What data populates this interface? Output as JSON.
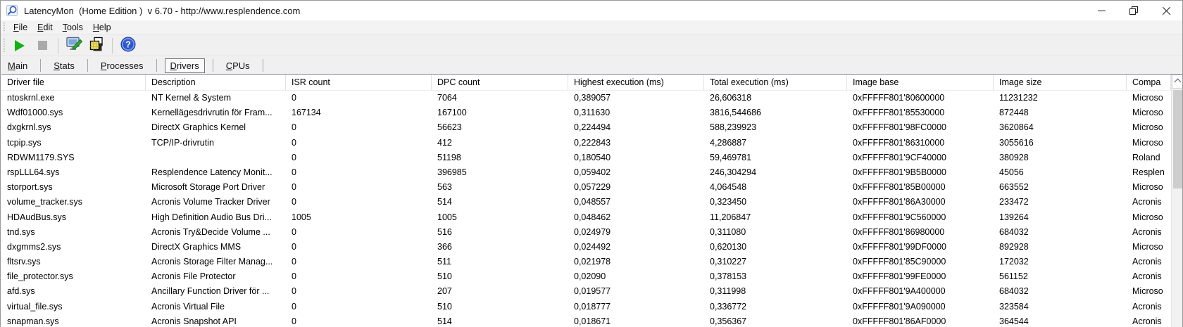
{
  "window": {
    "title": "LatencyMon  (Home Edition )  v 6.70 - http://www.resplendence.com",
    "app_icon": "latencymon-magnifier-icon",
    "controls": [
      "minimize",
      "restore",
      "close"
    ]
  },
  "menu": {
    "items": [
      "File",
      "Edit",
      "Tools",
      "Help"
    ]
  },
  "toolbar": {
    "buttons": [
      {
        "name": "start-monitor-button",
        "icon": "play-icon",
        "enabled": true
      },
      {
        "name": "stop-monitor-button",
        "icon": "stop-icon",
        "enabled": false
      },
      {
        "name": "separator"
      },
      {
        "name": "edit-options-button",
        "icon": "monitor-pencil-icon",
        "enabled": true
      },
      {
        "name": "report-button",
        "icon": "stacked-windows-icon",
        "enabled": true
      },
      {
        "name": "separator"
      },
      {
        "name": "help-button",
        "icon": "help-question-icon",
        "enabled": true
      }
    ]
  },
  "tabs": [
    {
      "label": "Main",
      "selected": false
    },
    {
      "label": "Stats",
      "selected": false
    },
    {
      "label": "Processes",
      "selected": false
    },
    {
      "label": "Drivers",
      "selected": true
    },
    {
      "label": "CPUs",
      "selected": false
    }
  ],
  "table": {
    "columns": [
      "Driver file",
      "Description",
      "ISR count",
      "DPC count",
      "Highest execution (ms)",
      "Total execution (ms)",
      "Image base",
      "Image size",
      "Compa"
    ],
    "column_keys": [
      "driver-file",
      "description",
      "isr-count",
      "dpc-count",
      "highest-execution",
      "total-execution",
      "image-base",
      "image-size",
      "company"
    ],
    "rows": [
      [
        "ntoskrnl.exe",
        "NT Kernel & System",
        "0",
        "7064",
        "0,389057",
        "26,606318",
        "0xFFFFF801'80600000",
        "11231232",
        "Microso"
      ],
      [
        "Wdf01000.sys",
        "Kernellägesdrivrutin för Fram...",
        "167134",
        "167100",
        "0,311630",
        "3816,544686",
        "0xFFFFF801'85530000",
        "872448",
        "Microso"
      ],
      [
        "dxgkrnl.sys",
        "DirectX Graphics Kernel",
        "0",
        "56623",
        "0,224494",
        "588,239923",
        "0xFFFFF801'98FC0000",
        "3620864",
        "Microso"
      ],
      [
        "tcpip.sys",
        "TCP/IP-drivrutin",
        "0",
        "412",
        "0,222843",
        "4,286887",
        "0xFFFFF801'86310000",
        "3055616",
        "Microso"
      ],
      [
        "RDWM1179.SYS",
        "",
        "0",
        "51198",
        "0,180540",
        "59,469781",
        "0xFFFFF801'9CF40000",
        "380928",
        "Roland"
      ],
      [
        "rspLLL64.sys",
        "Resplendence Latency Monit...",
        "0",
        "396985",
        "0,059402",
        "246,304294",
        "0xFFFFF801'9B5B0000",
        "45056",
        "Resplen"
      ],
      [
        "storport.sys",
        "Microsoft Storage Port Driver",
        "0",
        "563",
        "0,057229",
        "4,064548",
        "0xFFFFF801'85B00000",
        "663552",
        "Microso"
      ],
      [
        "volume_tracker.sys",
        "Acronis Volume Tracker Driver",
        "0",
        "514",
        "0,048557",
        "0,323450",
        "0xFFFFF801'86A30000",
        "233472",
        "Acronis"
      ],
      [
        "HDAudBus.sys",
        "High Definition Audio Bus Dri...",
        "1005",
        "1005",
        "0,048462",
        "11,206847",
        "0xFFFFF801'9C560000",
        "139264",
        "Microso"
      ],
      [
        "tnd.sys",
        "Acronis Try&Decide Volume ...",
        "0",
        "516",
        "0,024979",
        "0,311080",
        "0xFFFFF801'86980000",
        "684032",
        "Acronis"
      ],
      [
        "dxgmms2.sys",
        "DirectX Graphics MMS",
        "0",
        "366",
        "0,024492",
        "0,620130",
        "0xFFFFF801'99DF0000",
        "892928",
        "Microso"
      ],
      [
        "fltsrv.sys",
        "Acronis Storage Filter Manag...",
        "0",
        "511",
        "0,021978",
        "0,310227",
        "0xFFFFF801'85C90000",
        "172032",
        "Acronis"
      ],
      [
        "file_protector.sys",
        "Acronis File Protector",
        "0",
        "510",
        "0,02090",
        "0,378153",
        "0xFFFFF801'99FE0000",
        "561152",
        "Acronis"
      ],
      [
        "afd.sys",
        "Ancillary Function Driver för ...",
        "0",
        "207",
        "0,019577",
        "0,311998",
        "0xFFFFF801'9A400000",
        "684032",
        "Microso"
      ],
      [
        "virtual_file.sys",
        "Acronis Virtual File",
        "0",
        "510",
        "0,018777",
        "0,336772",
        "0xFFFFF801'9A090000",
        "323584",
        "Acronis"
      ],
      [
        "snapman.sys",
        "Acronis Snapshot API",
        "0",
        "514",
        "0,018671",
        "0,356367",
        "0xFFFFF801'86AF0000",
        "364544",
        "Acronis"
      ]
    ]
  },
  "colors": {
    "play_green": "#12b212",
    "stop_gray": "#a9a9a9",
    "help_blue": "#2b57cf",
    "listview_border": "#828790"
  }
}
